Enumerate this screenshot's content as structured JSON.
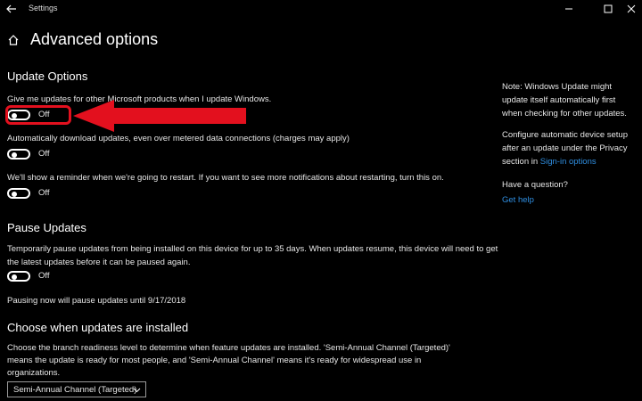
{
  "window": {
    "title": "Settings",
    "controls": {
      "minimize": "—",
      "maximize": "□",
      "close": "✕"
    }
  },
  "header": {
    "title": "Advanced options"
  },
  "update_options": {
    "heading": "Update Options",
    "items": [
      {
        "label": "Give me updates for other Microsoft products when I update Windows.",
        "state": "Off"
      },
      {
        "label": "Automatically download updates, even over metered data connections (charges may apply)",
        "state": "Off"
      },
      {
        "label": "We'll show a reminder when we're going to restart. If you want to see more notifications about restarting, turn this on.",
        "state": "Off"
      }
    ]
  },
  "pause_updates": {
    "heading": "Pause Updates",
    "description_line1": "Temporarily pause updates from being installed on this device for up to 35 days. When updates resume, this device will need to get",
    "description_line2": "the latest updates before it can be paused again.",
    "state": "Off",
    "status": "Pausing now will pause updates until 9/17/2018"
  },
  "choose_updates": {
    "heading": "Choose when updates are installed",
    "description_line1": "Choose the branch readiness level to determine when feature updates are installed. 'Semi-Annual Channel (Targeted)'",
    "description_line2": "means the update is ready for most people, and 'Semi-Annual Channel' means it's ready for widespread use in",
    "description_line3": "organizations.",
    "dropdown_value": "Semi-Annual Channel (Targeted)"
  },
  "side_panel": {
    "note_line1": "Note: Windows Update might",
    "note_line2": "update itself automatically first",
    "note_line3": "when checking for other updates.",
    "setup_line1": "Configure automatic device setup",
    "setup_line2": "after an update under the Privacy",
    "setup_line3_prefix": "section in ",
    "setup_link": "Sign-in options",
    "question": "Have a question?",
    "help_link": "Get help"
  },
  "colors": {
    "accent": "#2f8ee0",
    "annotation": "#e3101e",
    "background": "#000000"
  },
  "annotation": {
    "type": "red-arrow-pointing-left",
    "target": "first toggle"
  }
}
